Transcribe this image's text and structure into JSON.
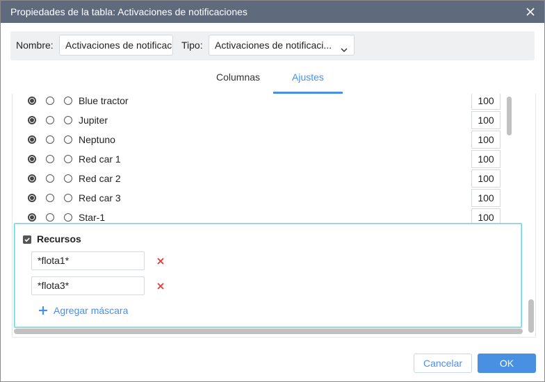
{
  "window": {
    "title": "Propiedades de la tabla: Activaciones de notificaciones"
  },
  "topbar": {
    "name_label": "Nombre:",
    "name_value": "Activaciones de notificaciones",
    "type_label": "Tipo:",
    "type_value": "Activaciones de notificaci..."
  },
  "tabs": [
    {
      "label": "Columnas",
      "active": false
    },
    {
      "label": "Ajustes",
      "active": true
    }
  ],
  "list": {
    "rows": [
      {
        "name": "Blue tractor",
        "selected": 0,
        "value": "100"
      },
      {
        "name": "Jupiter",
        "selected": 0,
        "value": "100"
      },
      {
        "name": "Neptuno",
        "selected": 0,
        "value": "100"
      },
      {
        "name": "Red car 1",
        "selected": 0,
        "value": "100"
      },
      {
        "name": "Red car 2",
        "selected": 0,
        "value": "100"
      },
      {
        "name": "Red car 3",
        "selected": 0,
        "value": "100"
      },
      {
        "name": "Star-1",
        "selected": 0,
        "value": "100"
      }
    ]
  },
  "resources": {
    "title": "Recursos",
    "checked": true,
    "masks": [
      "*flota1*",
      "*flota3*"
    ],
    "add_label": "Agregar máscara"
  },
  "footer": {
    "cancel_label": "Cancelar",
    "ok_label": "OK"
  },
  "colors": {
    "titlebar": "#5f6b7c",
    "accent": "#4a8fe7",
    "delete": "#e5383b",
    "highlight_border": "#6fd6de"
  }
}
